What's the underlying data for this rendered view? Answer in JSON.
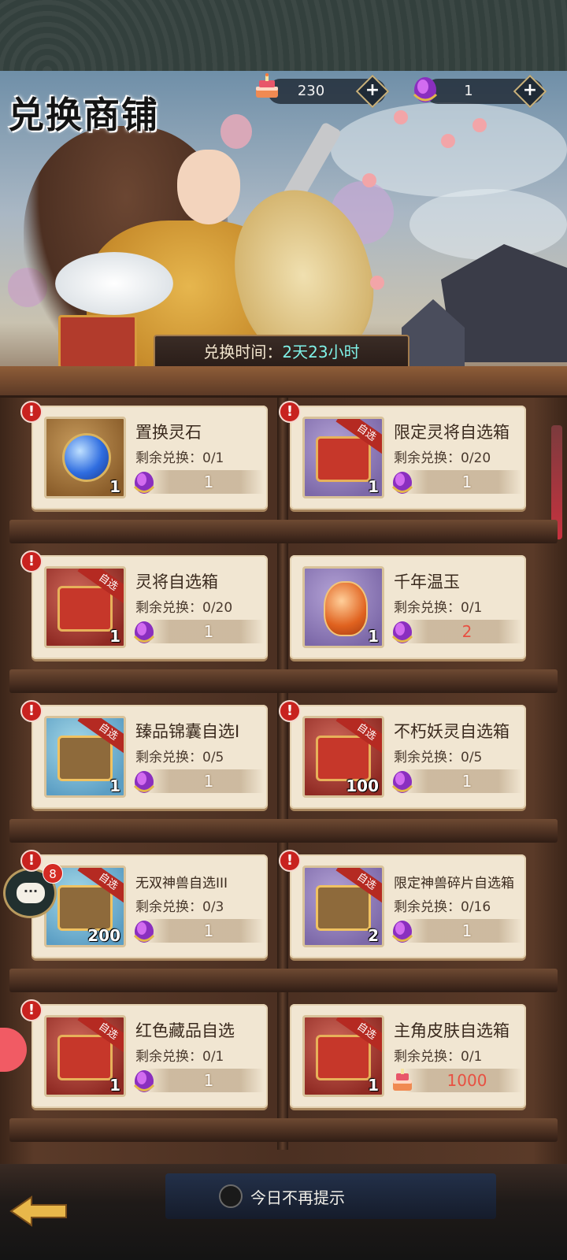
{
  "header": {
    "title": "兑换商铺",
    "timer_label": "兑换时间：",
    "timer_value": "2天23小时"
  },
  "resources": [
    {
      "icon": "cake-icon",
      "value": "230"
    },
    {
      "icon": "purple-gem-icon",
      "value": "1"
    }
  ],
  "items": [
    {
      "name": "置换灵石",
      "remaining": "剩余兑换：0/1",
      "count": "1",
      "price": "1",
      "price_icon": "purple-gem-icon",
      "thumb": "orb",
      "alert": true,
      "tag": ""
    },
    {
      "name": "限定灵将自选箱",
      "remaining": "剩余兑换：0/20",
      "count": "1",
      "price": "1",
      "price_icon": "purple-gem-icon",
      "thumb": "chest",
      "alert": true,
      "tag": "自选"
    },
    {
      "name": "灵将自选箱",
      "remaining": "剩余兑换：0/20",
      "count": "1",
      "price": "1",
      "price_icon": "purple-gem-icon",
      "thumb": "chest",
      "alert": true,
      "tag": "自选"
    },
    {
      "name": "千年温玉",
      "remaining": "剩余兑换：0/1",
      "count": "1",
      "price": "2",
      "price_icon": "purple-gem-icon",
      "thumb": "stone",
      "alert": false,
      "tag": ""
    },
    {
      "name": "臻品锦囊自选I",
      "remaining": "剩余兑换：0/5",
      "count": "1",
      "price": "1",
      "price_icon": "purple-gem-icon",
      "thumb": "crate",
      "alert": true,
      "tag": "自选"
    },
    {
      "name": "不朽妖灵自选箱",
      "remaining": "剩余兑换：0/5",
      "count": "100",
      "price": "1",
      "price_icon": "purple-gem-icon",
      "thumb": "chest",
      "alert": true,
      "tag": "自选"
    },
    {
      "name": "无双神兽自选III",
      "remaining": "剩余兑换：0/3",
      "count": "200",
      "price": "1",
      "price_icon": "purple-gem-icon",
      "thumb": "crate",
      "alert": true,
      "tag": "自选"
    },
    {
      "name": "限定神兽碎片自选箱",
      "remaining": "剩余兑换：0/16",
      "count": "2",
      "price": "1",
      "price_icon": "purple-gem-icon",
      "thumb": "crate",
      "alert": true,
      "tag": "自选"
    },
    {
      "name": "红色藏品自选",
      "remaining": "剩余兑换：0/1",
      "count": "1",
      "price": "1",
      "price_icon": "purple-gem-icon",
      "thumb": "chest",
      "alert": true,
      "tag": "自选"
    },
    {
      "name": "主角皮肤自选箱",
      "remaining": "剩余兑换：0/1",
      "count": "1",
      "price": "1000",
      "price_icon": "cake-icon",
      "thumb": "chest",
      "alert": false,
      "tag": "自选"
    }
  ],
  "footer": {
    "checkbox_label": "今日不再提示",
    "chat_badge": "8"
  },
  "colors": {
    "alert": "#c8221f",
    "price_highlight": "#e85042",
    "timer_value": "#7ff1e7"
  }
}
